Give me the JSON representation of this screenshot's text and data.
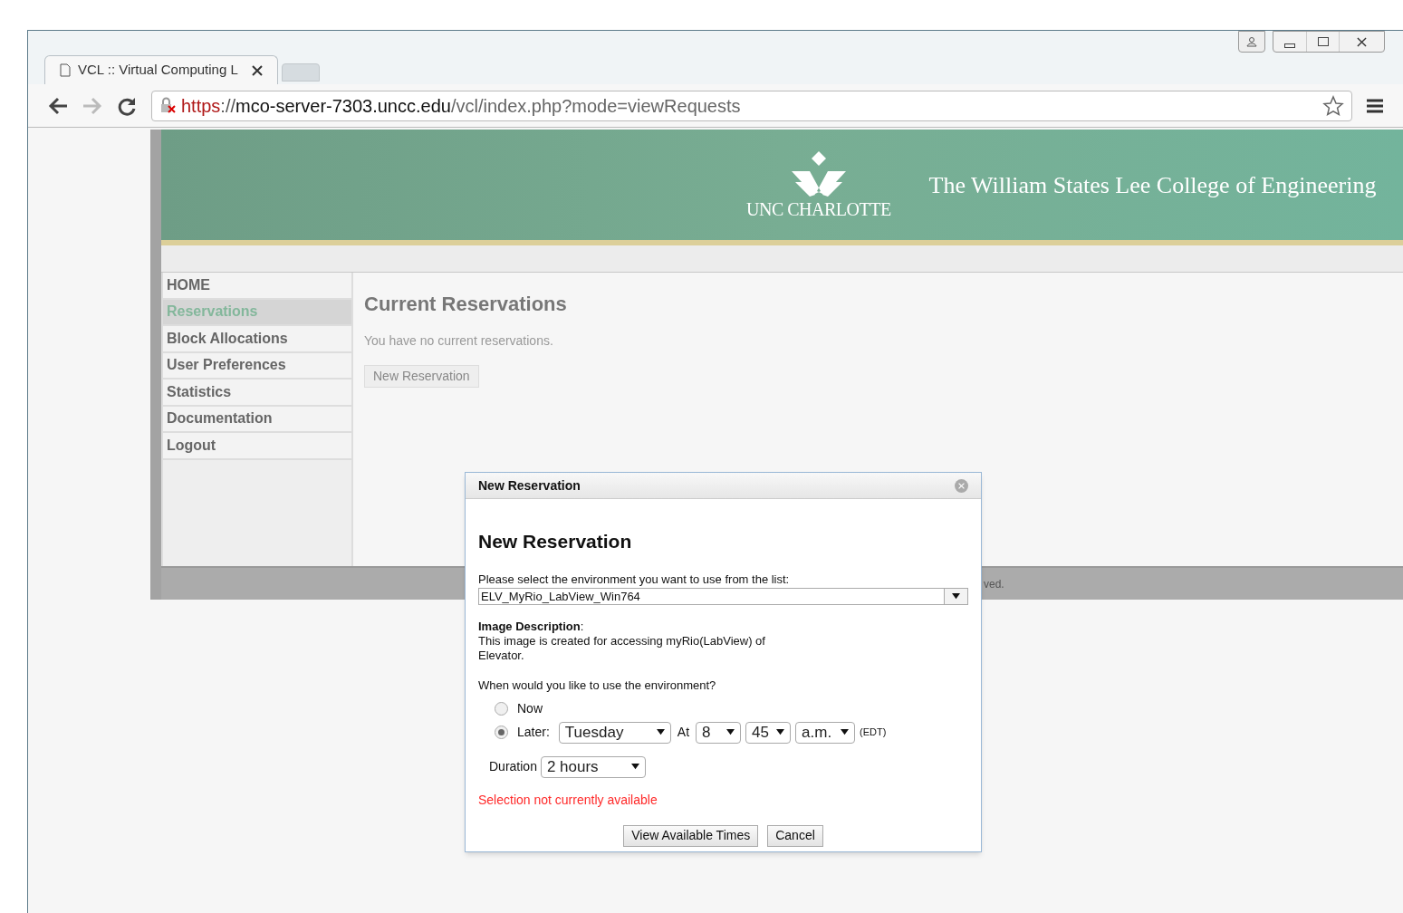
{
  "browser": {
    "tabs": [
      {
        "title": "VCL :: Virtual Computing L",
        "selected": true
      }
    ],
    "address_bar": {
      "insecure": true,
      "url_parts": [
        {
          "kind": "scheme",
          "text": "https"
        },
        {
          "kind": "separator",
          "text": "://"
        },
        {
          "kind": "host",
          "text": "mco-server-7303.uncc.edu"
        },
        {
          "kind": "path",
          "text": "/vcl/index.php?mode=viewRequests"
        }
      ]
    }
  },
  "header": {
    "logo_text": "UNC CHARLOTTE",
    "title": "The William States Lee College of Engineering"
  },
  "sidebar": {
    "items": [
      {
        "label": "HOME",
        "selected": false
      },
      {
        "label": "Reservations",
        "selected": true
      },
      {
        "label": "Block Allocations",
        "selected": false
      },
      {
        "label": "User Preferences",
        "selected": false
      },
      {
        "label": "Statistics",
        "selected": false
      },
      {
        "label": "Documentation",
        "selected": false
      },
      {
        "label": "Logout",
        "selected": false
      }
    ]
  },
  "main": {
    "title": "Current Reservations",
    "message": "You have no current reservations.",
    "button": "New Reservation"
  },
  "footer": {
    "text": "ved."
  },
  "dialog": {
    "title": "New Reservation",
    "heading": "New Reservation",
    "env_label": "Please select the environment you want to use from the list:",
    "environment": "ELV_MyRio_LabView_Win764",
    "description_label": "Image Description",
    "description_colon": ":",
    "description": "This image is created for accessing myRio(LabView) of Elevator.",
    "when_label": "When would you like to use the environment?",
    "options": [
      {
        "label": "Now",
        "selected": false
      },
      {
        "label": "Later:",
        "selected": true
      }
    ],
    "day": "Tuesday",
    "at_label": "At",
    "hour": "8",
    "minute": "45",
    "meridiem": "a.m.",
    "timezone": "(EDT)",
    "duration_label": "Duration",
    "duration": "2 hours",
    "error": "Selection not currently available",
    "buttons": [
      "View Available Times",
      "Cancel"
    ]
  }
}
